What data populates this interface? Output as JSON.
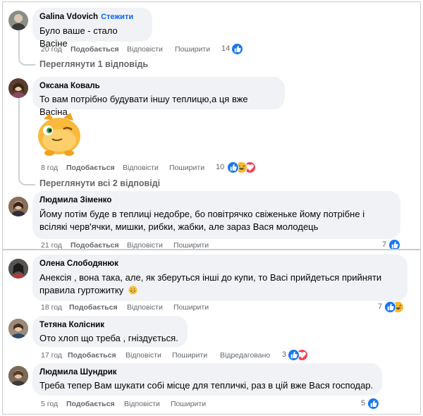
{
  "comments_top": [
    {
      "author": "Galina Vdovich",
      "follow_label": "Стежити",
      "text": "Було ваше - стало Васіне",
      "time": "20 год",
      "like_label": "Подобається",
      "reply_label": "Відповісти",
      "share_label": "Поширити",
      "reaction_count": "14",
      "reactions": [
        "like-icon"
      ],
      "view_replies": "Переглянути 1 відповідь"
    },
    {
      "author": "Оксана Коваль",
      "text": "То вам потрібно будувати іншу теплицю,а ця вже Васіна",
      "sticker": "winking-cat-sticker",
      "time": "8 год",
      "like_label": "Подобається",
      "reply_label": "Відповісти",
      "share_label": "Поширити",
      "reaction_count": "10",
      "reactions": [
        "like-icon",
        "haha-icon",
        "love-icon"
      ],
      "view_replies": "Переглянути всі 2 відповіді"
    },
    {
      "author": "Людмила Зіменко",
      "text_lines": [
        "Йому потім буде в теплиці недобре, бо повітрячко свіженьке йому потрібне і",
        "всілякі черв'ячки, мишки, рибки, жабки, але зараз Вася молодець"
      ],
      "time": "21 год",
      "like_label": "Подобається",
      "reply_label": "Відповісти",
      "share_label": "Поширити",
      "reaction_count": "7",
      "reactions": [
        "like-icon"
      ]
    }
  ],
  "comments_bottom": [
    {
      "author": "Олена Слободянюк",
      "text_lines": [
        "Анексія , вона така, але, як зберуться інші до купи, то Васі прийдеться прийняти",
        "правила гуртожитку"
      ],
      "emoji": "grinning-face-icon",
      "time": "18 год",
      "like_label": "Подобається",
      "reply_label": "Відповісти",
      "share_label": "Поширити",
      "reaction_count": "7",
      "reactions": [
        "like-icon",
        "haha-icon"
      ]
    },
    {
      "author": "Тетяна Колісник",
      "text": "Ото хлоп що треба , гніздується.",
      "time": "17 год",
      "like_label": "Подобається",
      "reply_label": "Відповісти",
      "share_label": "Поширити",
      "edited_label": "Відредаговано",
      "reaction_count": "3",
      "reactions": [
        "like-icon",
        "love-icon"
      ]
    },
    {
      "author": "Людмила Шундрик",
      "text": "Треба тепер Вам шукати собі місце для тепличкі, раз в цій вже Вася господар.",
      "time": "5 год",
      "like_label": "Подобається",
      "reply_label": "Відповісти",
      "share_label": "Поширити",
      "reaction_count": "5",
      "reactions": [
        "like-icon"
      ]
    }
  ],
  "colors": {
    "bubble": "#f0f2f5",
    "meta_text": "#65676b",
    "like_blue": "#1877f2",
    "follow_blue": "#0866ff"
  }
}
